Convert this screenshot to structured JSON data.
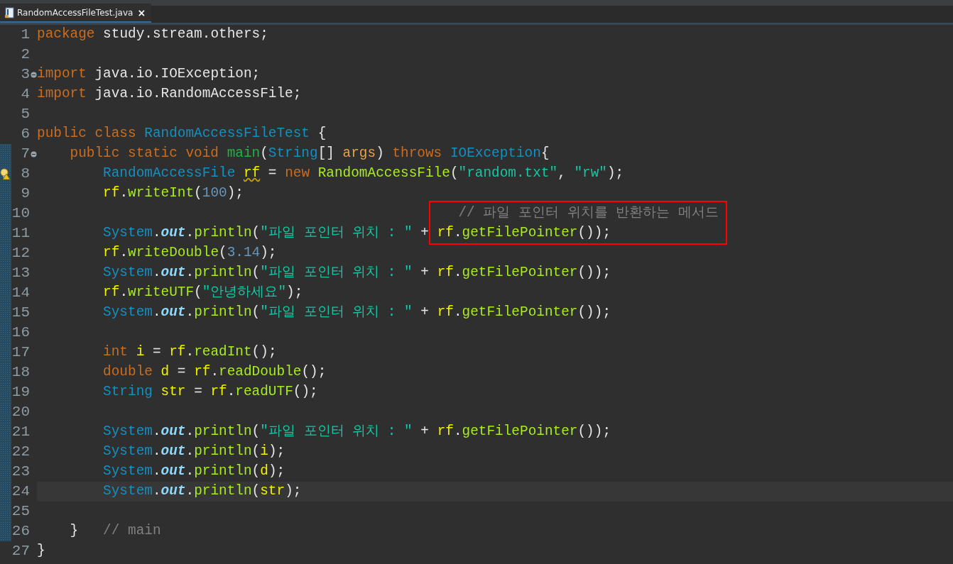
{
  "tab": {
    "label": "RandomAccessFileTest.java",
    "close": "×",
    "selected": true
  },
  "lines": [
    {
      "number": "1",
      "collapsible": false,
      "warning": false,
      "changed": false,
      "current": false,
      "tokens": [
        {
          "kind": "kw",
          "text": "package"
        },
        {
          "kind": "text",
          "text": " study.stream.others;"
        }
      ]
    },
    {
      "number": "2",
      "collapsible": false,
      "warning": false,
      "changed": false,
      "current": false
    },
    {
      "number": "3",
      "collapsible": true,
      "warning": false,
      "changed": false,
      "current": false,
      "tokens": [
        {
          "kind": "kw",
          "text": "import"
        },
        {
          "kind": "text",
          "text": " java.io.IOException;"
        }
      ]
    },
    {
      "number": "4",
      "collapsible": false,
      "warning": false,
      "changed": false,
      "current": false,
      "tokens": [
        {
          "kind": "kw",
          "text": "import"
        },
        {
          "kind": "text",
          "text": " java.io.RandomAccessFile;"
        }
      ]
    },
    {
      "number": "5",
      "collapsible": false,
      "warning": false,
      "changed": false,
      "current": false
    },
    {
      "number": "6",
      "collapsible": false,
      "warning": false,
      "changed": false,
      "current": false,
      "tokens": [
        {
          "kind": "kw",
          "text": "public class"
        },
        {
          "kind": "type",
          "text": " RandomAccessFileTest"
        },
        {
          "kind": "text",
          "text": " {"
        }
      ]
    },
    {
      "number": "7",
      "collapsible": true,
      "warning": false,
      "changed": true,
      "current": false,
      "tokens": [
        {
          "kind": "kw",
          "text": "    public static void"
        },
        {
          "kind": "decl",
          "text": " main"
        },
        {
          "kind": "text",
          "text": "("
        },
        {
          "kind": "type",
          "text": "String"
        },
        {
          "kind": "text",
          "text": "[]"
        },
        {
          "kind": "param",
          "text": " args"
        },
        {
          "kind": "text",
          "text": ")"
        },
        {
          "kind": "kw",
          "text": " throws"
        },
        {
          "kind": "type",
          "text": " IOException"
        },
        {
          "kind": "text",
          "text": "{"
        }
      ]
    },
    {
      "number": "8",
      "collapsible": false,
      "warning": true,
      "changed": true,
      "current": false,
      "tokens": [
        {
          "kind": "type",
          "text": "        RandomAccessFile"
        },
        {
          "kind": "local-warn",
          "text": " rf"
        },
        {
          "kind": "text",
          "text": " = "
        },
        {
          "kind": "kw",
          "text": "new"
        },
        {
          "kind": "method",
          "text": " RandomAccessFile"
        },
        {
          "kind": "text",
          "text": "("
        },
        {
          "kind": "string",
          "text": "\"random.txt\""
        },
        {
          "kind": "text",
          "text": ", "
        },
        {
          "kind": "string",
          "text": "\"rw\""
        },
        {
          "kind": "text",
          "text": ");"
        }
      ]
    },
    {
      "number": "9",
      "collapsible": false,
      "warning": false,
      "changed": true,
      "current": false,
      "tokens": [
        {
          "kind": "local",
          "text": "        rf"
        },
        {
          "kind": "text",
          "text": "."
        },
        {
          "kind": "method",
          "text": "writeInt"
        },
        {
          "kind": "text",
          "text": "("
        },
        {
          "kind": "number",
          "text": "100"
        },
        {
          "kind": "text",
          "text": ");"
        }
      ]
    },
    {
      "number": "10",
      "collapsible": false,
      "warning": false,
      "changed": true,
      "current": false,
      "tokens": [
        {
          "kind": "comment",
          "text": "                                                   // 파일 포인터 위치를 반환하는 메서드",
          "boxed": true
        }
      ]
    },
    {
      "number": "11",
      "collapsible": false,
      "warning": false,
      "changed": true,
      "current": false,
      "tokens": [
        {
          "kind": "type",
          "text": "        System"
        },
        {
          "kind": "text",
          "text": "."
        },
        {
          "kind": "field",
          "text": "out"
        },
        {
          "kind": "text",
          "text": "."
        },
        {
          "kind": "method",
          "text": "println"
        },
        {
          "kind": "text",
          "text": "("
        },
        {
          "kind": "string",
          "text": "\"파일 포인터 위치 : \""
        },
        {
          "kind": "text",
          "text": " + "
        },
        {
          "kind": "local",
          "text": "rf",
          "boxed": true
        },
        {
          "kind": "text",
          "text": ".",
          "boxed": true
        },
        {
          "kind": "method",
          "text": "getFilePointer",
          "boxed": true
        },
        {
          "kind": "text",
          "text": "());",
          "boxed": true
        }
      ]
    },
    {
      "number": "12",
      "collapsible": false,
      "warning": false,
      "changed": true,
      "current": false,
      "tokens": [
        {
          "kind": "local",
          "text": "        rf"
        },
        {
          "kind": "text",
          "text": "."
        },
        {
          "kind": "method",
          "text": "writeDouble"
        },
        {
          "kind": "text",
          "text": "("
        },
        {
          "kind": "number",
          "text": "3.14"
        },
        {
          "kind": "text",
          "text": ");"
        }
      ]
    },
    {
      "number": "13",
      "collapsible": false,
      "warning": false,
      "changed": true,
      "current": false,
      "tokens": [
        {
          "kind": "type",
          "text": "        System"
        },
        {
          "kind": "text",
          "text": "."
        },
        {
          "kind": "field",
          "text": "out"
        },
        {
          "kind": "text",
          "text": "."
        },
        {
          "kind": "method",
          "text": "println"
        },
        {
          "kind": "text",
          "text": "("
        },
        {
          "kind": "string",
          "text": "\"파일 포인터 위치 : \""
        },
        {
          "kind": "text",
          "text": " + "
        },
        {
          "kind": "local",
          "text": "rf"
        },
        {
          "kind": "text",
          "text": "."
        },
        {
          "kind": "method",
          "text": "getFilePointer"
        },
        {
          "kind": "text",
          "text": "());"
        }
      ]
    },
    {
      "number": "14",
      "collapsible": false,
      "warning": false,
      "changed": true,
      "current": false,
      "tokens": [
        {
          "kind": "local",
          "text": "        rf"
        },
        {
          "kind": "text",
          "text": "."
        },
        {
          "kind": "method",
          "text": "writeUTF"
        },
        {
          "kind": "text",
          "text": "("
        },
        {
          "kind": "string",
          "text": "\"안녕하세요\""
        },
        {
          "kind": "text",
          "text": ");"
        }
      ]
    },
    {
      "number": "15",
      "collapsible": false,
      "warning": false,
      "changed": true,
      "current": false,
      "tokens": [
        {
          "kind": "type",
          "text": "        System"
        },
        {
          "kind": "text",
          "text": "."
        },
        {
          "kind": "field",
          "text": "out"
        },
        {
          "kind": "text",
          "text": "."
        },
        {
          "kind": "method",
          "text": "println"
        },
        {
          "kind": "text",
          "text": "("
        },
        {
          "kind": "string",
          "text": "\"파일 포인터 위치 : \""
        },
        {
          "kind": "text",
          "text": " + "
        },
        {
          "kind": "local",
          "text": "rf"
        },
        {
          "kind": "text",
          "text": "."
        },
        {
          "kind": "method",
          "text": "getFilePointer"
        },
        {
          "kind": "text",
          "text": "());"
        }
      ]
    },
    {
      "number": "16",
      "collapsible": false,
      "warning": false,
      "changed": true,
      "current": false
    },
    {
      "number": "17",
      "collapsible": false,
      "warning": false,
      "changed": true,
      "current": false,
      "tokens": [
        {
          "kind": "kw",
          "text": "        int"
        },
        {
          "kind": "local",
          "text": " i"
        },
        {
          "kind": "text",
          "text": " = "
        },
        {
          "kind": "local",
          "text": "rf"
        },
        {
          "kind": "text",
          "text": "."
        },
        {
          "kind": "method",
          "text": "readInt"
        },
        {
          "kind": "text",
          "text": "();"
        }
      ]
    },
    {
      "number": "18",
      "collapsible": false,
      "warning": false,
      "changed": true,
      "current": false,
      "tokens": [
        {
          "kind": "kw",
          "text": "        double"
        },
        {
          "kind": "local",
          "text": " d"
        },
        {
          "kind": "text",
          "text": " = "
        },
        {
          "kind": "local",
          "text": "rf"
        },
        {
          "kind": "text",
          "text": "."
        },
        {
          "kind": "method",
          "text": "readDouble"
        },
        {
          "kind": "text",
          "text": "();"
        }
      ]
    },
    {
      "number": "19",
      "collapsible": false,
      "warning": false,
      "changed": true,
      "current": false,
      "tokens": [
        {
          "kind": "type",
          "text": "        String"
        },
        {
          "kind": "local",
          "text": " str"
        },
        {
          "kind": "text",
          "text": " = "
        },
        {
          "kind": "local",
          "text": "rf"
        },
        {
          "kind": "text",
          "text": "."
        },
        {
          "kind": "method",
          "text": "readUTF"
        },
        {
          "kind": "text",
          "text": "();"
        }
      ]
    },
    {
      "number": "20",
      "collapsible": false,
      "warning": false,
      "changed": true,
      "current": false
    },
    {
      "number": "21",
      "collapsible": false,
      "warning": false,
      "changed": true,
      "current": false,
      "tokens": [
        {
          "kind": "type",
          "text": "        System"
        },
        {
          "kind": "text",
          "text": "."
        },
        {
          "kind": "field",
          "text": "out"
        },
        {
          "kind": "text",
          "text": "."
        },
        {
          "kind": "method",
          "text": "println"
        },
        {
          "kind": "text",
          "text": "("
        },
        {
          "kind": "string",
          "text": "\"파일 포인터 위치 : \""
        },
        {
          "kind": "text",
          "text": " + "
        },
        {
          "kind": "local",
          "text": "rf"
        },
        {
          "kind": "text",
          "text": "."
        },
        {
          "kind": "method",
          "text": "getFilePointer"
        },
        {
          "kind": "text",
          "text": "());"
        }
      ]
    },
    {
      "number": "22",
      "collapsible": false,
      "warning": false,
      "changed": true,
      "current": false,
      "tokens": [
        {
          "kind": "type",
          "text": "        System"
        },
        {
          "kind": "text",
          "text": "."
        },
        {
          "kind": "field",
          "text": "out"
        },
        {
          "kind": "text",
          "text": "."
        },
        {
          "kind": "method",
          "text": "println"
        },
        {
          "kind": "text",
          "text": "("
        },
        {
          "kind": "local",
          "text": "i"
        },
        {
          "kind": "text",
          "text": ");"
        }
      ]
    },
    {
      "number": "23",
      "collapsible": false,
      "warning": false,
      "changed": true,
      "current": false,
      "tokens": [
        {
          "kind": "type",
          "text": "        System"
        },
        {
          "kind": "text",
          "text": "."
        },
        {
          "kind": "field",
          "text": "out"
        },
        {
          "kind": "text",
          "text": "."
        },
        {
          "kind": "method",
          "text": "println"
        },
        {
          "kind": "text",
          "text": "("
        },
        {
          "kind": "local",
          "text": "d"
        },
        {
          "kind": "text",
          "text": ");"
        }
      ]
    },
    {
      "number": "24",
      "collapsible": false,
      "warning": false,
      "changed": true,
      "current": true,
      "tokens": [
        {
          "kind": "type",
          "text": "        System"
        },
        {
          "kind": "text",
          "text": "."
        },
        {
          "kind": "field",
          "text": "out"
        },
        {
          "kind": "text",
          "text": "."
        },
        {
          "kind": "method",
          "text": "println"
        },
        {
          "kind": "text",
          "text": "("
        },
        {
          "kind": "local",
          "text": "str"
        },
        {
          "kind": "text",
          "text": ");"
        }
      ]
    },
    {
      "number": "25",
      "collapsible": false,
      "warning": false,
      "changed": true,
      "current": false
    },
    {
      "number": "26",
      "collapsible": false,
      "warning": false,
      "changed": true,
      "current": false,
      "tokens": [
        {
          "kind": "text",
          "text": "    }"
        },
        {
          "kind": "comment",
          "text": "   // main"
        }
      ]
    },
    {
      "number": "27",
      "collapsible": false,
      "warning": false,
      "changed": false,
      "current": false,
      "tokens": [
        {
          "kind": "text",
          "text": "}"
        }
      ]
    }
  ]
}
